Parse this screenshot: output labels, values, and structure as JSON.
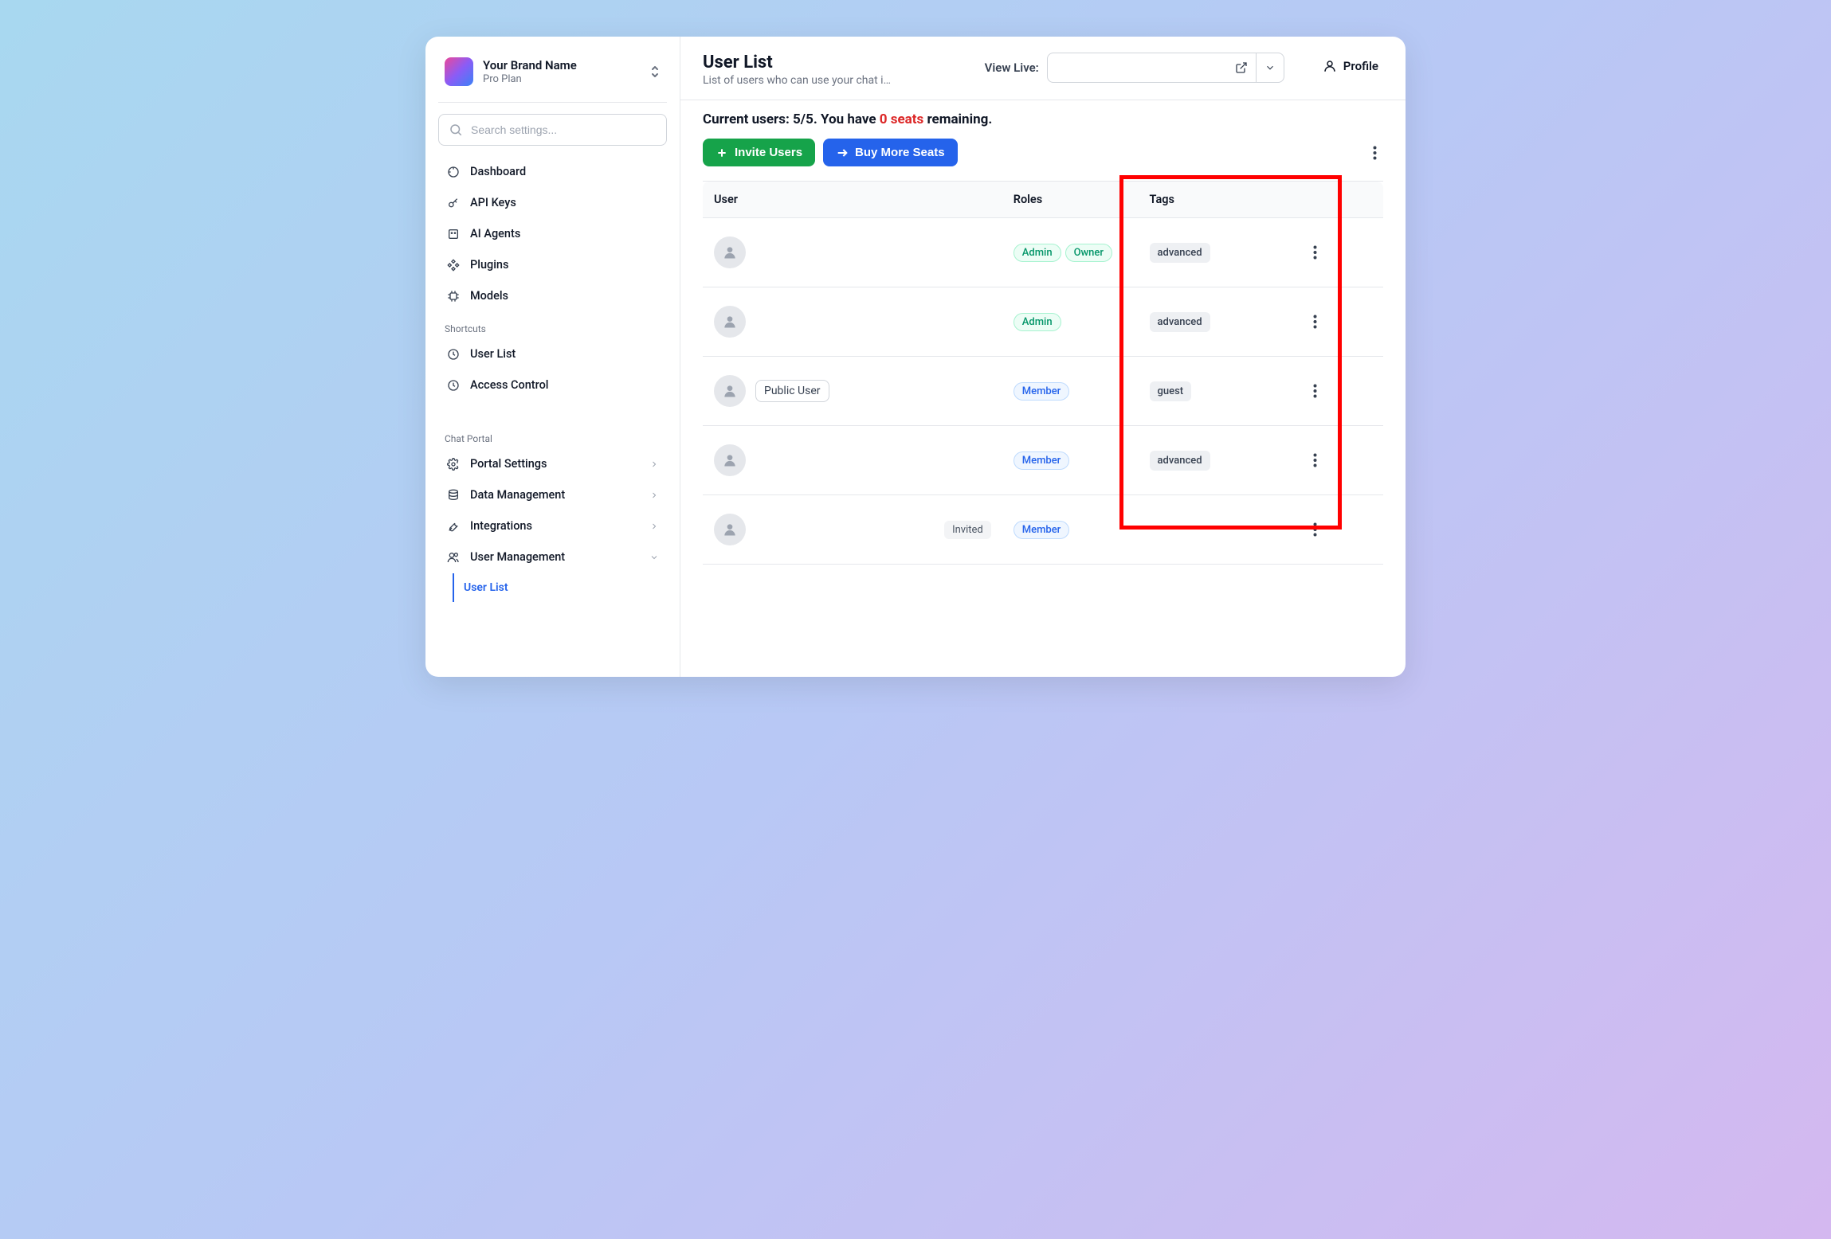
{
  "brand": {
    "name": "Your Brand Name",
    "plan": "Pro Plan"
  },
  "search": {
    "placeholder": "Search settings..."
  },
  "nav": {
    "main": [
      {
        "label": "Dashboard"
      },
      {
        "label": "API Keys"
      },
      {
        "label": "AI Agents"
      },
      {
        "label": "Plugins"
      },
      {
        "label": "Models"
      }
    ],
    "shortcuts_label": "Shortcuts",
    "shortcuts": [
      {
        "label": "User List"
      },
      {
        "label": "Access Control"
      }
    ],
    "portal_label": "Chat Portal",
    "portal": [
      {
        "label": "Portal Settings"
      },
      {
        "label": "Data Management"
      },
      {
        "label": "Integrations"
      },
      {
        "label": "User Management"
      }
    ],
    "active_sub": "User List"
  },
  "header": {
    "title": "User List",
    "subtitle": "List of users who can use your chat i…",
    "view_live_label": "View Live:",
    "profile_label": "Profile"
  },
  "banner": {
    "prefix": "Current users: ",
    "count": "5/5",
    "middle": ". You have ",
    "seats": "0 seats",
    "suffix": " remaining.",
    "invite_btn": "Invite Users",
    "buy_btn": "Buy More Seats"
  },
  "table": {
    "columns": {
      "user": "User",
      "roles": "Roles",
      "tags": "Tags"
    },
    "rows": [
      {
        "name": "",
        "roles": [
          "Admin",
          "Owner"
        ],
        "tags": [
          "advanced"
        ],
        "status": ""
      },
      {
        "name": "",
        "roles": [
          "Admin"
        ],
        "tags": [
          "advanced"
        ],
        "status": ""
      },
      {
        "name": "Public User",
        "roles": [
          "Member"
        ],
        "tags": [
          "guest"
        ],
        "status": ""
      },
      {
        "name": "",
        "roles": [
          "Member"
        ],
        "tags": [
          "advanced"
        ],
        "status": ""
      },
      {
        "name": "",
        "roles": [
          "Member"
        ],
        "tags": [],
        "status": "Invited"
      }
    ]
  },
  "annotation": {
    "highlight_column": "Tags"
  }
}
